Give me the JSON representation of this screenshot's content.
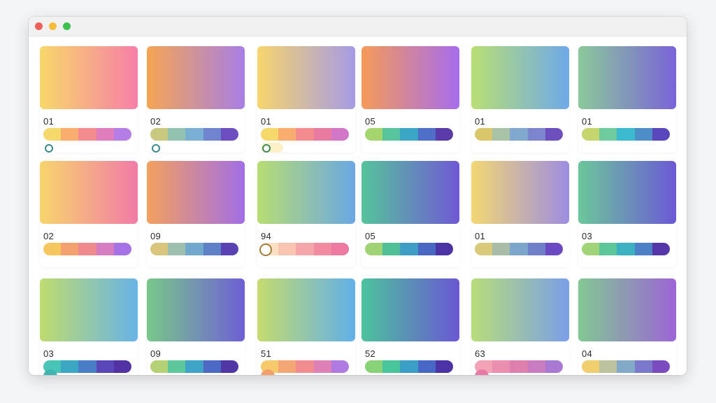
{
  "window": {
    "controls": [
      "close-button",
      "minimize-button",
      "maximize-button"
    ]
  },
  "cards": [
    {
      "label": "01",
      "swatch": [
        "#f7d86a",
        "#f77fa8"
      ],
      "palette": [
        "#f7d86a",
        "#f6ad6e",
        "#f48b8f",
        "#e07dbd",
        "#b57de6"
      ],
      "extra": "ring"
    },
    {
      "label": "02",
      "swatch": [
        "#f5a653",
        "#a77ee6"
      ],
      "palette": [
        "#c9c97f",
        "#93c3b0",
        "#7ab0d3",
        "#6f85cf",
        "#6b4fc1"
      ],
      "extra": "ring"
    },
    {
      "label": "01",
      "swatch": [
        "#f7d56d",
        "#a59be6"
      ],
      "palette": [
        "#f7d86a",
        "#f6ad6e",
        "#f48b8f",
        "#e97aa0",
        "#d277c7"
      ],
      "extra": "ring-pill"
    },
    {
      "label": "05",
      "swatch": [
        "#f59a58",
        "#a66cee"
      ],
      "palette": [
        "#a5d56e",
        "#57c49b",
        "#3ba6c7",
        "#4f6fc6",
        "#5b3ba7"
      ],
      "extra": ""
    },
    {
      "label": "01",
      "swatch": [
        "#b9df73",
        "#6ea9ea"
      ],
      "palette": [
        "#d9c86b",
        "#a9c3a9",
        "#80a9cf",
        "#7d85cf",
        "#6a4fbd"
      ],
      "extra": ""
    },
    {
      "label": "01",
      "swatch": [
        "#8bc99a",
        "#7a63d9"
      ],
      "palette": [
        "#c7d56d",
        "#6fcb9d",
        "#3ebad0",
        "#4d8ec9",
        "#5a46bc"
      ],
      "extra": ""
    },
    {
      "label": "02",
      "swatch": [
        "#f7d56d",
        "#f27ba7"
      ],
      "palette": [
        "#f7c75f",
        "#f5a06f",
        "#ee8a8e",
        "#d47ec1",
        "#a573e6"
      ],
      "extra": ""
    },
    {
      "label": "09",
      "swatch": [
        "#f4a05f",
        "#a26ee6"
      ],
      "palette": [
        "#d9c57c",
        "#9cc0ad",
        "#72a8cc",
        "#5d80c7",
        "#5a42b3"
      ],
      "extra": ""
    },
    {
      "label": "94",
      "swatch": [
        "#b8dd73",
        "#6aa7e4"
      ],
      "palette": [
        "#fbe1c2",
        "#f8c5b2",
        "#f4a7a9",
        "#f08ba1",
        "#ee79a1"
      ],
      "extra": "knob"
    },
    {
      "label": "05",
      "swatch": [
        "#56c49c",
        "#6f58d4"
      ],
      "palette": [
        "#9fd375",
        "#52c096",
        "#3f9ec6",
        "#4968c4",
        "#4c33a3"
      ],
      "extra": ""
    },
    {
      "label": "01",
      "swatch": [
        "#f3d774",
        "#9d8de2"
      ],
      "palette": [
        "#d8c97b",
        "#a8bca8",
        "#7ca6cb",
        "#6f80c8",
        "#6b49c2"
      ],
      "extra": ""
    },
    {
      "label": "03",
      "swatch": [
        "#6cc79b",
        "#6b59d6"
      ],
      "palette": [
        "#a1d378",
        "#5ec799",
        "#3bb1c2",
        "#4c7fc6",
        "#5637aa"
      ],
      "extra": ""
    },
    {
      "label": "03",
      "swatch": [
        "#bfdc6e",
        "#68b3e8"
      ],
      "palette": [
        "#48c5b7",
        "#3ba7c3",
        "#4a7dc7",
        "#5946b7",
        "#5332a4"
      ],
      "extra": "dot-teal"
    },
    {
      "label": "09",
      "swatch": [
        "#78c98a",
        "#6f5fd6"
      ],
      "palette": [
        "#b4d175",
        "#5ec79c",
        "#3ea3c7",
        "#4c6ac4",
        "#5136a6"
      ],
      "extra": ""
    },
    {
      "label": "51",
      "swatch": [
        "#c6db6e",
        "#5fb0ea"
      ],
      "palette": [
        "#f6c96a",
        "#f4a675",
        "#f08b8e",
        "#dd81b8",
        "#b07be0"
      ],
      "extra": "dot-orange"
    },
    {
      "label": "52",
      "swatch": [
        "#4cc39c",
        "#6a57d4"
      ],
      "palette": [
        "#88d277",
        "#48c59b",
        "#3a9ec7",
        "#4868c5",
        "#4c33a5"
      ],
      "extra": ""
    },
    {
      "label": "63",
      "swatch": [
        "#b8dd79",
        "#7a9fe8"
      ],
      "palette": [
        "#f2a4b6",
        "#eb8fb0",
        "#de7fae",
        "#c97cc2",
        "#a87ad4"
      ],
      "extra": "dot-pink"
    },
    {
      "label": "04",
      "swatch": [
        "#82c893",
        "#9c65d6"
      ],
      "palette": [
        "#f1cf70",
        "#bcc29d",
        "#83a9c8",
        "#7a79cb",
        "#7b4cc0"
      ],
      "extra": ""
    }
  ]
}
